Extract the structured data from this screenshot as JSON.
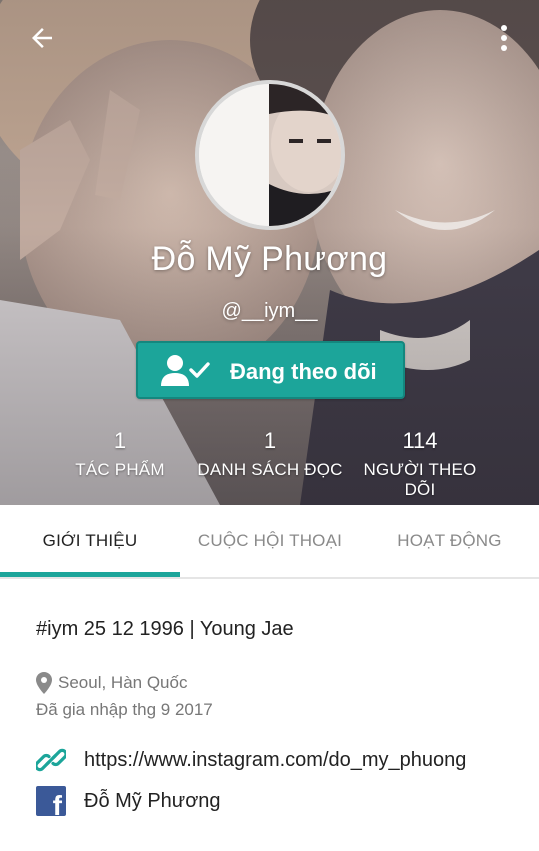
{
  "profile": {
    "display_name": "Đỗ Mỹ Phương",
    "username": "@__iym__",
    "follow_button_label": "Đang theo dõi"
  },
  "stats": [
    {
      "value": "1",
      "label": "TÁC PHẨM"
    },
    {
      "value": "1",
      "label": "DANH SÁCH ĐỌC"
    },
    {
      "value": "114",
      "label": "NGƯỜI THEO DÕI"
    }
  ],
  "tabs": [
    {
      "label": "GIỚI THIỆU",
      "active": true
    },
    {
      "label": "CUỘC HỘI THOẠI",
      "active": false
    },
    {
      "label": "HOẠT ĐỘNG",
      "active": false
    }
  ],
  "about": {
    "bio": "#iym 25 12 1996 | Young Jae",
    "location": "Seoul, Hàn Quốc",
    "joined": "Đã gia nhập thg 9 2017",
    "website": "https://www.instagram.com/do_my_phuong",
    "facebook": "Đỗ Mỹ Phương"
  },
  "icons": {
    "back": "arrow-left-icon",
    "more": "more-vertical-icon",
    "follow": "user-check-icon",
    "location": "location-pin-icon",
    "link": "link-icon",
    "facebook": "facebook-icon"
  },
  "colors": {
    "accent": "#1ca59a",
    "facebook": "#3b5998",
    "muted_text": "#777777"
  }
}
